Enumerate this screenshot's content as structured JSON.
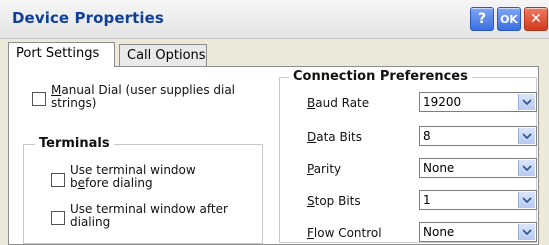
{
  "window": {
    "title": "Device Properties",
    "help_label": "?",
    "ok_label": "OK",
    "close_label": "✕"
  },
  "tabs": [
    {
      "label": "Port Settings",
      "active": true
    },
    {
      "label": "Call Options",
      "active": false
    }
  ],
  "manual_dial": {
    "line1": "Manual Dial (user supplies dial",
    "line2": "strings)"
  },
  "terminals": {
    "title": "Terminals",
    "before": {
      "line1": "Use terminal window",
      "line2": "before dialing"
    },
    "after": {
      "line1": "Use terminal window after",
      "line2": "dialing"
    }
  },
  "connection": {
    "title": "Connection Preferences",
    "fields": [
      {
        "label": "Baud Rate",
        "value": "19200"
      },
      {
        "label": "Data Bits",
        "value": "8"
      },
      {
        "label": "Parity",
        "value": "None"
      },
      {
        "label": "Stop Bits",
        "value": "1"
      },
      {
        "label": "Flow Control",
        "value": "None"
      }
    ]
  }
}
